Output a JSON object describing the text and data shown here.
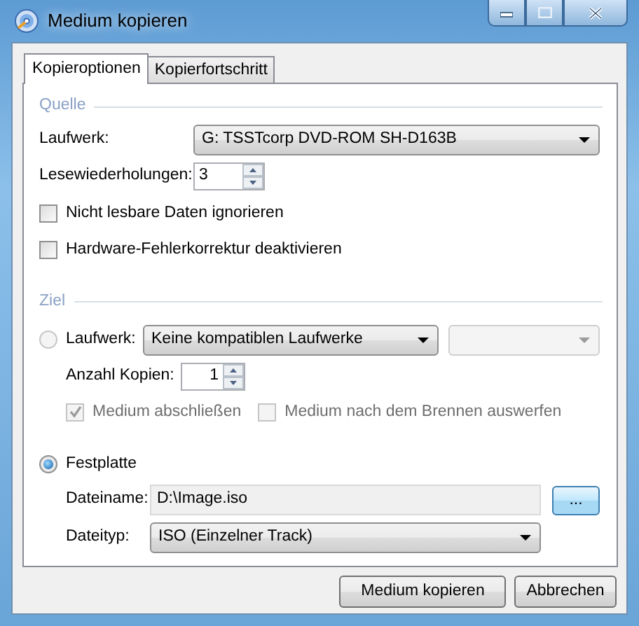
{
  "window": {
    "title": "Medium kopieren"
  },
  "tabs": [
    {
      "label": "Kopieroptionen",
      "selected": true
    },
    {
      "label": "Kopierfortschritt",
      "selected": false
    }
  ],
  "source": {
    "heading": "Quelle",
    "drive": {
      "label": "Laufwerk:",
      "value": "G: TSSTcorp DVD-ROM SH-D163B"
    },
    "retries": {
      "label": "Lesewiederholungen:",
      "value": "3"
    },
    "options": [
      {
        "label": "Nicht lesbare Daten ignorieren",
        "checked": false,
        "disabled": false
      },
      {
        "label": "Hardware-Fehlerkorrektur deaktivieren",
        "checked": false,
        "disabled": false
      }
    ]
  },
  "target": {
    "heading": "Ziel",
    "drive_option": {
      "label": "Laufwerk:",
      "selected": false
    },
    "drive": {
      "value": "Keine kompatiblen Laufwerke"
    },
    "speed": {
      "disabled": true
    },
    "copies": {
      "label": "Anzahl Kopien:",
      "value": "1"
    },
    "options": [
      {
        "label": "Medium abschließen",
        "checked": true,
        "disabled": true
      },
      {
        "label": "Medium nach dem Brennen auswerfen",
        "checked": false,
        "disabled": true
      }
    ],
    "file_option": {
      "label": "Festplatte",
      "selected": true
    },
    "filename": {
      "label": "Dateiname:",
      "value": "D:\\Image.iso"
    },
    "browse": {
      "label": "..."
    },
    "filetype": {
      "label": "Dateityp:",
      "value": "ISO (Einzelner Track)"
    }
  },
  "buttons": [
    {
      "label": "Medium kopieren"
    },
    {
      "label": "Abbrechen"
    }
  ]
}
